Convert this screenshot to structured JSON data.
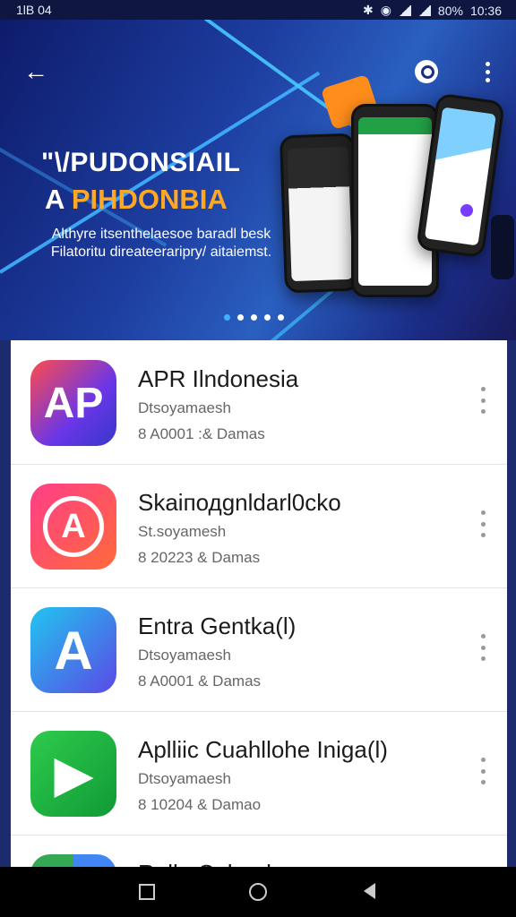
{
  "status_bar": {
    "left": "1lB 04",
    "right_icons": [
      "bluetooth-icon",
      "location-icon",
      "signal-icon",
      "signal-icon"
    ],
    "battery": "80%",
    "time": "10:36"
  },
  "banner": {
    "headline_line1": "\"\\/PUDONSIAIL",
    "headline_line2_prefix": "A ",
    "headline_line2_accent": "PIHDONBIA",
    "subtitle": "Althyre itsenthelaesoe baradl besk Filatoritu direateeraripry/ aitaiemst.",
    "pager_count": 5,
    "pager_active_index": 0,
    "accent_color": "#ffa824"
  },
  "apps": [
    {
      "title": "APR Ilndonesia",
      "line2": "Dtsoyamaesh",
      "line3": "8 A0001 :& Damas",
      "icon_glyph": "AP",
      "icon_name": "apr-indonesia-app-icon"
    },
    {
      "title": "Skaiподgnldarl0cko",
      "line2": "St.soyamesh",
      "line3": "8 20223 & Damas",
      "icon_glyph": "A",
      "icon_name": "circle-a-app-icon"
    },
    {
      "title": "Entra Gentka(l)",
      "line2": "Dtsoyamaesh",
      "line3": "8 A0001 & Damas",
      "icon_glyph": "A",
      "icon_name": "a-letter-app-icon"
    },
    {
      "title": "Aplliic Cuahllohe Iniga(l)",
      "line2": "Dtsoyamaesh",
      "line3": "8 10204 & Damao",
      "icon_glyph": "▶",
      "icon_name": "play-app-icon"
    },
    {
      "title": "Rallu Cuhanh",
      "line2": "",
      "line3": "",
      "icon_glyph": "",
      "icon_name": "multicolor-app-icon"
    }
  ],
  "nav": [
    "recent-apps-icon",
    "home-icon",
    "back-icon"
  ]
}
